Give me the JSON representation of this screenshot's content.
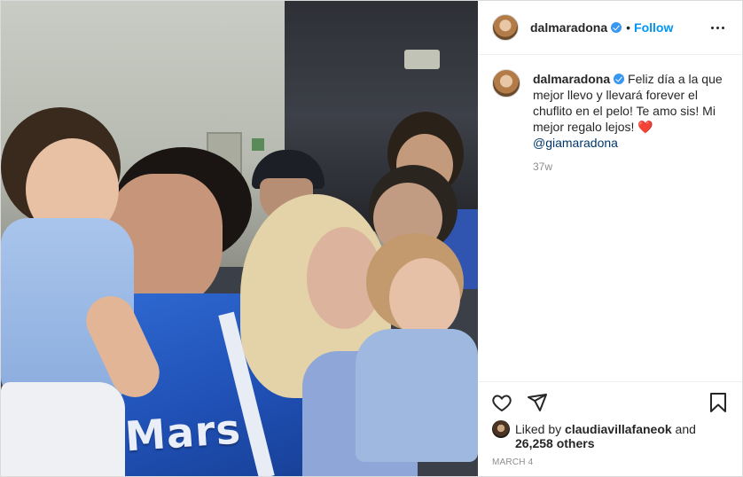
{
  "post": {
    "username": "dalmaradona",
    "follow_label": "Follow",
    "separator": "•",
    "photo_text": "Mars"
  },
  "caption": {
    "username": "dalmaradona",
    "text": "Feliz día a la que mejor llevo y llevará forever el chuflito en el pelo! Te amo sis! Mi mejor regalo lejos!",
    "emoji": "❤️",
    "mention": "@giamaradona",
    "age": "37w"
  },
  "likes": {
    "prefix": "Liked by",
    "user": "claudiavillafaneok",
    "conjunction": "and",
    "others": "26,258 others"
  },
  "date": "MARCH 4",
  "icons": [
    "verified-badge-icon",
    "more-options-icon",
    "heart-icon",
    "share-icon",
    "bookmark-icon"
  ]
}
